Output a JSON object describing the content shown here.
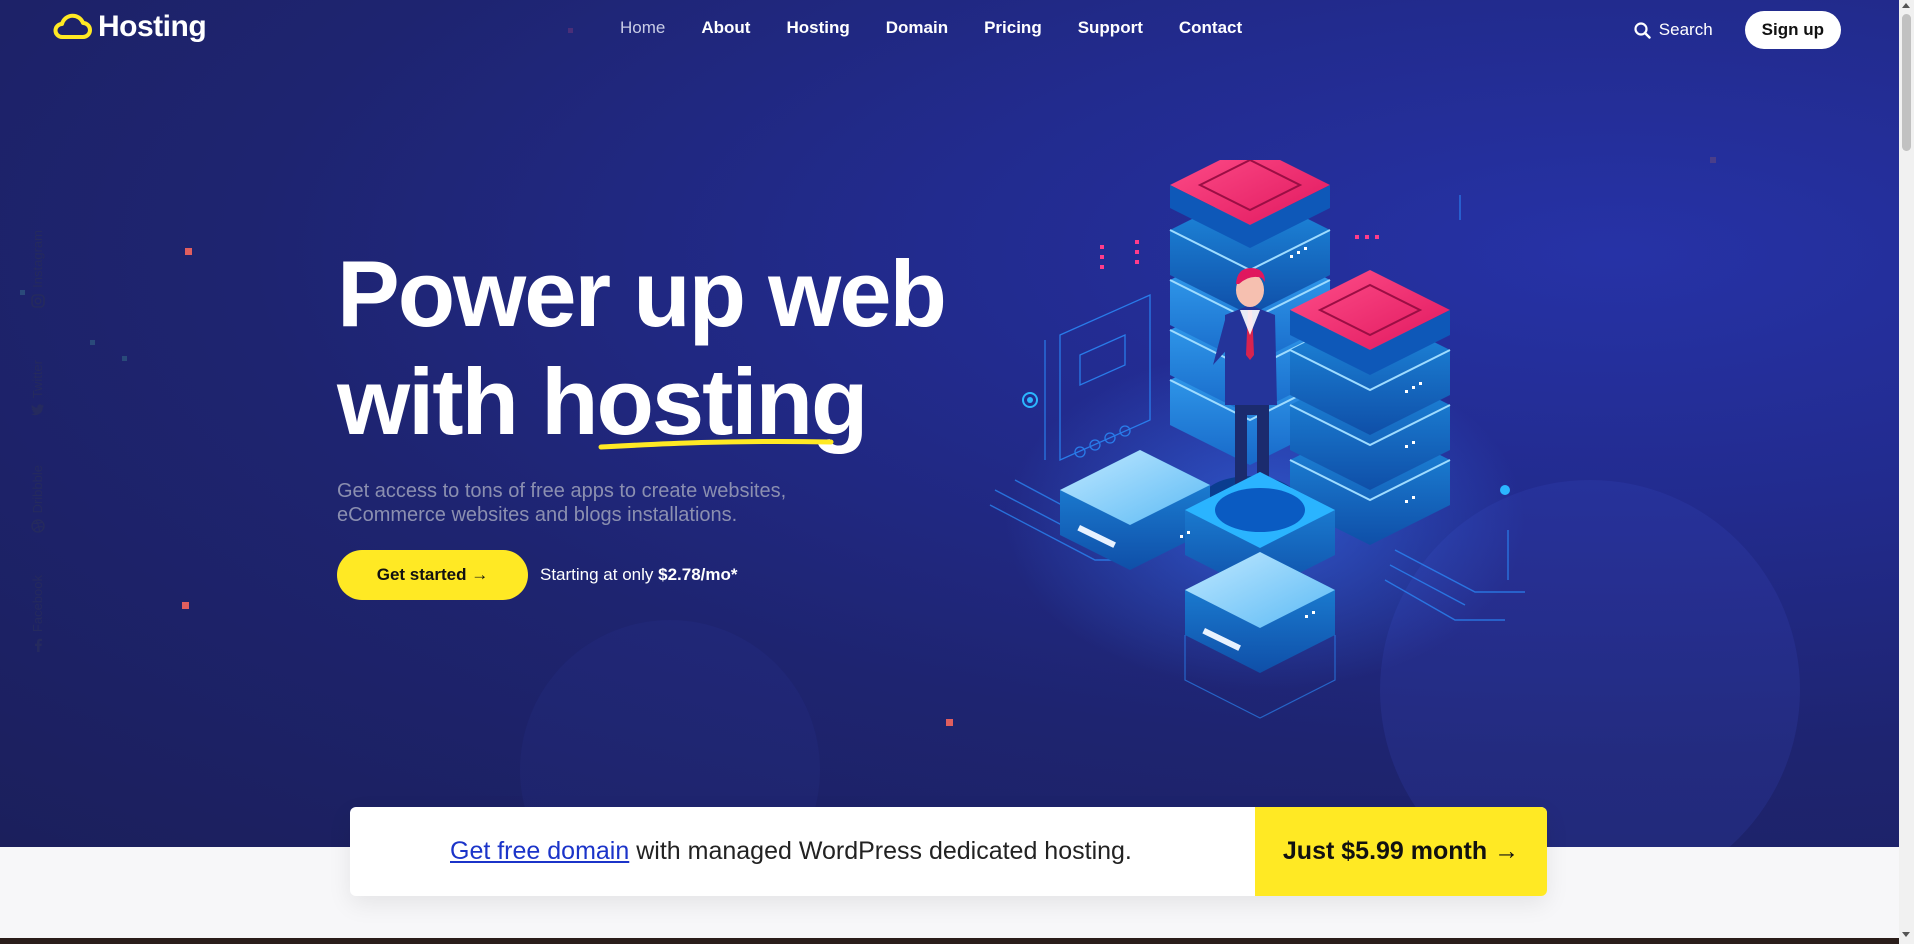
{
  "brand": {
    "name": "Hosting",
    "logo_icon": "cloud-icon",
    "accent": "#ffe924"
  },
  "nav": {
    "items": [
      {
        "label": "Home",
        "active": true
      },
      {
        "label": "About"
      },
      {
        "label": "Hosting"
      },
      {
        "label": "Domain"
      },
      {
        "label": "Pricing"
      },
      {
        "label": "Support"
      },
      {
        "label": "Contact"
      }
    ],
    "search_label": "Search",
    "signup_label": "Sign up"
  },
  "social": [
    {
      "label": "Instagram",
      "icon": "instagram-icon"
    },
    {
      "label": "Twitter",
      "icon": "twitter-icon"
    },
    {
      "label": "Dribbble",
      "icon": "dribbble-icon"
    },
    {
      "label": "Facebook",
      "icon": "facebook-icon"
    }
  ],
  "hero": {
    "headline_line1": "Power up web",
    "headline_line2": "with hosting",
    "subtext": "Get access to tons of free apps to create websites, eCommerce websites and blogs installations.",
    "cta_label": "Get started →",
    "starting_prefix": "Starting at only",
    "starting_price": "$2.78/mo*"
  },
  "banner": {
    "link_text": "Get free domain",
    "text": "with managed WordPress dedicated hosting.",
    "price_label": "Just $5.99 month →"
  },
  "colors": {
    "hero_bg": "#1e2470",
    "button_yellow": "#ffe924",
    "link_blue": "#1b34c9"
  }
}
